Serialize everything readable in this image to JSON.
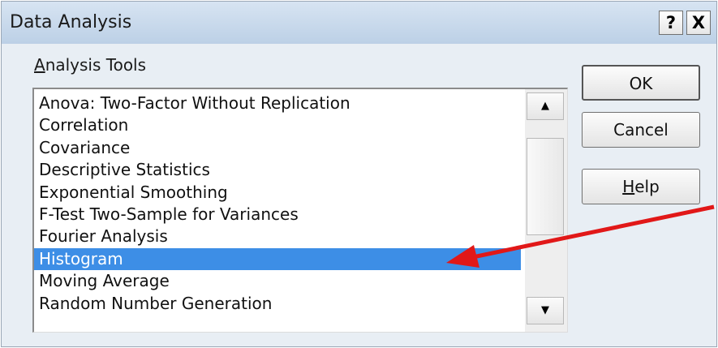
{
  "dialog": {
    "title": "Data Analysis",
    "help_button": "?",
    "close_button": "X"
  },
  "group": {
    "label_prefix": "A",
    "label_rest": "nalysis Tools"
  },
  "list": {
    "items": [
      "Anova: Two-Factor Without Replication",
      "Correlation",
      "Covariance",
      "Descriptive Statistics",
      "Exponential Smoothing",
      "F-Test Two-Sample for Variances",
      "Fourier Analysis",
      "Histogram",
      "Moving Average",
      "Random Number Generation"
    ],
    "selected": "Histogram",
    "scroll_up_icon": "scroll-up-arrow",
    "scroll_down_icon": "scroll-down-arrow"
  },
  "buttons": {
    "ok": "OK",
    "cancel": "Cancel",
    "help_prefix": "H",
    "help_rest": "elp"
  },
  "annotation": {
    "arrow_color": "#e11818"
  },
  "colors": {
    "selection": "#3d8ee6",
    "titlebar": "#c9d9ec"
  }
}
